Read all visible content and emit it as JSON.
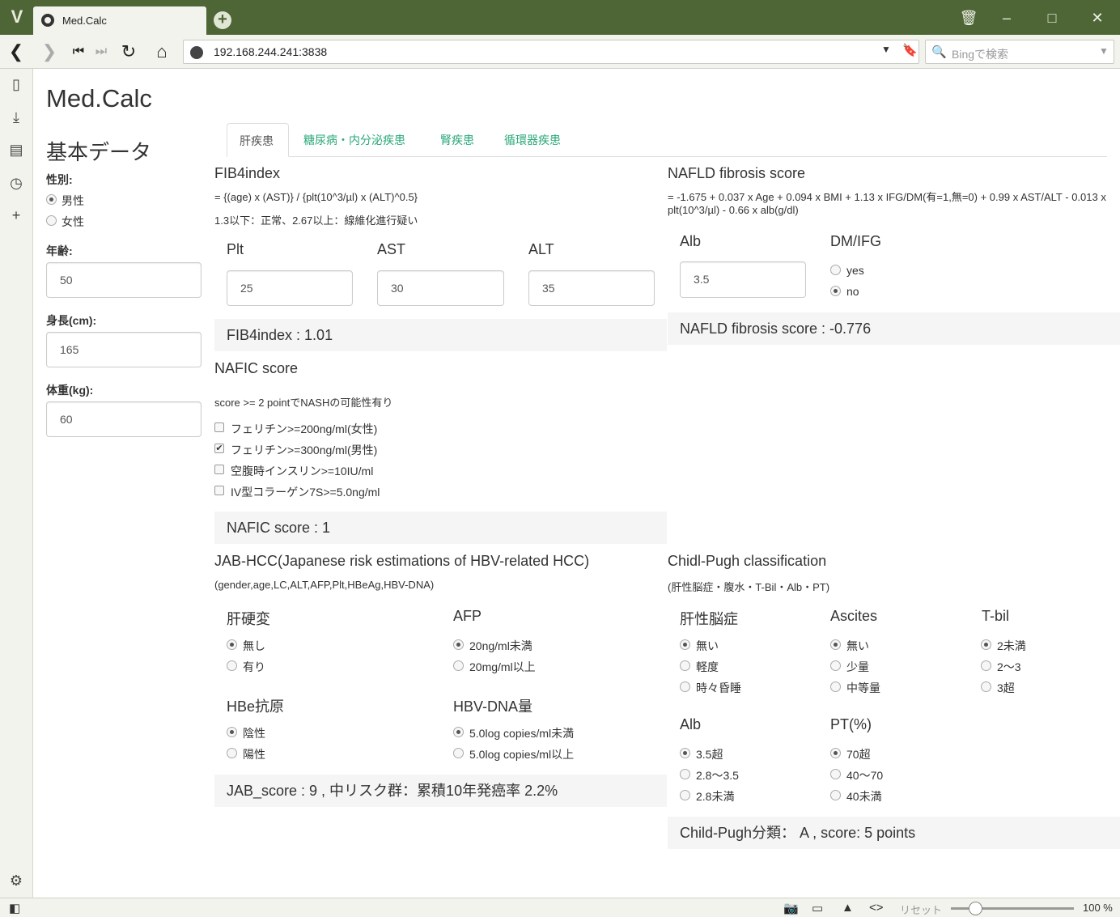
{
  "browser": {
    "tab_title": "Med.Calc",
    "url": "192.168.244.241:3838",
    "search_placeholder": "Bingで検索",
    "reset_label": "リセット",
    "zoom": "100 %"
  },
  "app": {
    "title": "Med.Calc"
  },
  "basic": {
    "heading": "基本データ",
    "sex_label": "性別:",
    "sex_options": [
      "男性",
      "女性"
    ],
    "sex_selected": "男性",
    "age_label": "年齢:",
    "age_value": "50",
    "height_label": "身長(cm):",
    "height_value": "165",
    "weight_label": "体重(kg):",
    "weight_value": "60"
  },
  "tabs": [
    "肝疾患",
    "糖尿病・内分泌疾患",
    "腎疾患",
    "循環器疾患"
  ],
  "active_tab": "肝疾患",
  "fib4": {
    "title": "FIB4index",
    "formula": "= {(age) x (AST)} / {plt(10^3/µl) x (ALT)^0.5}",
    "note": "1.3以下：正常、2.67以上：線維化進行疑い",
    "plt_label": "Plt",
    "plt_value": "25",
    "ast_label": "AST",
    "ast_value": "30",
    "alt_label": "ALT",
    "alt_value": "35",
    "result": "FIB4index : 1.01"
  },
  "nafld": {
    "title": "NAFLD fibrosis score",
    "formula": "= -1.675 + 0.037 x Age + 0.094 x BMI + 1.13 x IFG/DM(有=1,無=0) + 0.99 x AST/ALT - 0.013 x plt(10^3/µl) - 0.66 x alb(g/dl)",
    "alb_label": "Alb",
    "alb_value": "3.5",
    "dm_label": "DM/IFG",
    "dm_options": [
      "yes",
      "no"
    ],
    "dm_selected": "no",
    "result": "NAFLD fibrosis score : -0.776"
  },
  "nafic": {
    "title": "NAFIC score",
    "note": "score >= 2 pointでNASHの可能性有り",
    "items": [
      {
        "label": "フェリチン>=200ng/ml(女性)",
        "checked": false
      },
      {
        "label": "フェリチン>=300ng/ml(男性)",
        "checked": true
      },
      {
        "label": "空腹時インスリン>=10IU/ml",
        "checked": false
      },
      {
        "label": "IV型コラーゲン7S>=5.0ng/ml",
        "checked": false
      }
    ],
    "result": "NAFIC score : 1"
  },
  "jab": {
    "title": "JAB-HCC(Japanese risk estimations of HBV-related HCC)",
    "subtitle": "(gender,age,LC,ALT,AFP,Plt,HBeAg,HBV-DNA)",
    "lc_label": "肝硬変",
    "lc_options": [
      "無し",
      "有り"
    ],
    "afp_label": "AFP",
    "afp_options": [
      "20ng/ml未満",
      "20mg/ml以上"
    ],
    "hbe_label": "HBe抗原",
    "hbe_options": [
      "陰性",
      "陽性"
    ],
    "dna_label": "HBV-DNA量",
    "dna_options": [
      "5.0log copies/ml未満",
      "5.0log copies/ml以上"
    ],
    "result": "JAB_score : 9 , 中リスク群：累積10年発癌率 2.2%"
  },
  "childpugh": {
    "title": "Chidl-Pugh classification",
    "subtitle": "(肝性脳症・腹水・T-Bil・Alb・PT)",
    "enc_label": "肝性脳症",
    "enc_options": [
      "無い",
      "軽度",
      "時々昏睡"
    ],
    "asc_label": "Ascites",
    "asc_options": [
      "無い",
      "少量",
      "中等量"
    ],
    "tbil_label": "T-bil",
    "tbil_options": [
      "2未満",
      "2〜3",
      "3超"
    ],
    "alb_label": "Alb",
    "alb_options": [
      "3.5超",
      "2.8〜3.5",
      "2.8未満"
    ],
    "pt_label": "PT(%)",
    "pt_options": [
      "70超",
      "40〜70",
      "40未満"
    ],
    "result": "Child-Pugh分類： A , score: 5 points"
  }
}
